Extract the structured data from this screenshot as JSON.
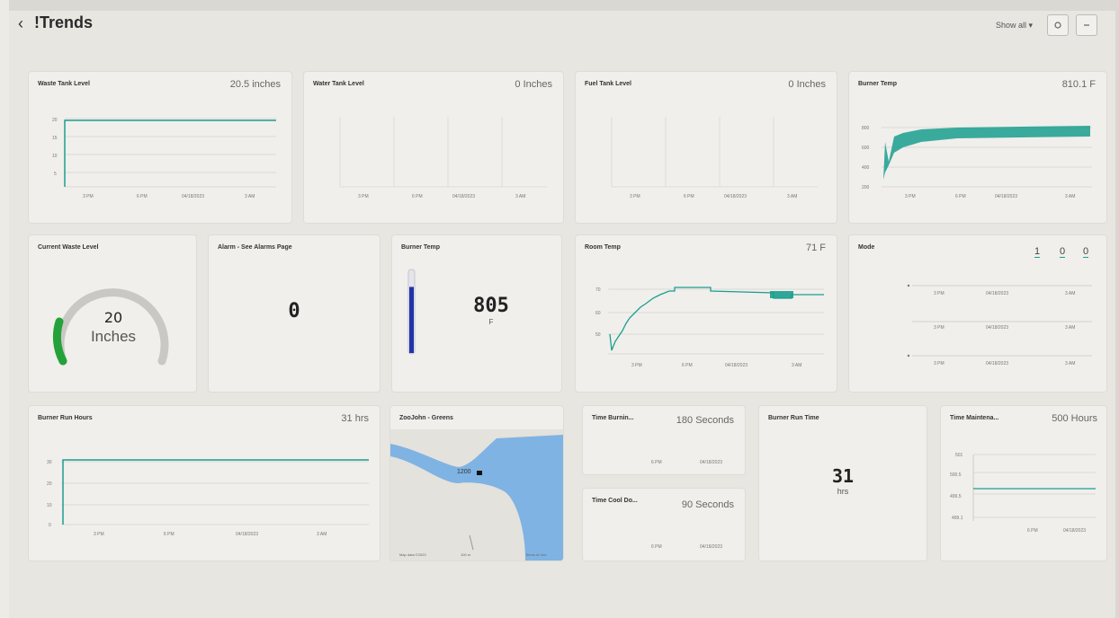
{
  "header": {
    "back": "‹",
    "title": "!Trends",
    "show_all": "Show all ▾",
    "btn1_icon": "settings-icon",
    "btn2_icon": "more-icon"
  },
  "colors": {
    "teal": "#1a9e8f",
    "gauge_green": "#23a23a",
    "thermo_blue": "#2233aa",
    "water": "#7fb3e3"
  },
  "cards": {
    "waste_tank": {
      "title": "Waste Tank Level",
      "value": "20.5 inches",
      "yticks": [
        "20",
        "15",
        "10",
        "5"
      ],
      "xticks": [
        "3 PM",
        "6 PM",
        "04/18/2023",
        "3 AM"
      ]
    },
    "water_tank": {
      "title": "Water Tank Level",
      "value": "0 Inches",
      "xticks": [
        "3 PM",
        "6 PM",
        "04/18/2023",
        "3 AM"
      ]
    },
    "fuel_tank": {
      "title": "Fuel Tank Level",
      "value": "0 Inches",
      "xticks": [
        "3 PM",
        "6 PM",
        "04/18/2023",
        "3 AM"
      ]
    },
    "burner_temp_trend": {
      "title": "Burner Temp",
      "value": "810.1 F",
      "yticks": [
        "800",
        "600",
        "400",
        "200"
      ],
      "xticks": [
        "3 PM",
        "6 PM",
        "04/18/2023",
        "3 AM"
      ]
    },
    "current_waste": {
      "title": "Current Waste Level",
      "value": "20",
      "unit": "Inches",
      "fraction": 0.3
    },
    "alarm": {
      "title": "Alarm - See Alarms Page",
      "value": "0"
    },
    "burner_temp_thermo": {
      "title": "Burner Temp",
      "value": "805",
      "unit": "F",
      "fraction": 0.8
    },
    "room_temp": {
      "title": "Room Temp",
      "value": "71 F",
      "yticks": [
        "70",
        "60",
        "50"
      ],
      "xticks": [
        "3 PM",
        "6 PM",
        "04/18/2023",
        "3 AM"
      ]
    },
    "mode": {
      "title": "Mode",
      "counters": [
        "1",
        "0",
        "0"
      ],
      "rows": [
        [
          "3 PM",
          "04/18/2023",
          "3 AM"
        ],
        [
          "3 PM",
          "04/18/2023",
          "3 AM"
        ],
        [
          "3 PM",
          "04/18/2023",
          "3 AM"
        ]
      ]
    },
    "burner_run_hours": {
      "title": "Burner Run Hours",
      "value": "31 hrs",
      "yticks": [
        "30",
        "20",
        "10",
        "0"
      ],
      "xticks": [
        "3 PM",
        "6 PM",
        "04/18/2023",
        "3 AM"
      ]
    },
    "map": {
      "title": "ZooJohn - Greens",
      "marker": "1200",
      "footer_left": "Map data ©2023",
      "footer_mid": "100 m",
      "footer_right": "Terms of Use"
    },
    "time_burning": {
      "title": "Time Burnin...",
      "value": "180 Seconds",
      "xticks": [
        "6 PM",
        "04/18/2023"
      ]
    },
    "time_cool": {
      "title": "Time Cool Do...",
      "value": "90 Seconds",
      "xticks": [
        "6 PM",
        "04/18/2023"
      ]
    },
    "burner_run_time": {
      "title": "Burner Run Time",
      "value": "31",
      "unit": "hrs"
    },
    "time_maint": {
      "title": "Time Maintena...",
      "value": "500 Hours",
      "yticks": [
        "501",
        "500.5",
        "499.5",
        "499.1"
      ],
      "xticks": [
        "6 PM",
        "04/18/2023"
      ]
    }
  }
}
